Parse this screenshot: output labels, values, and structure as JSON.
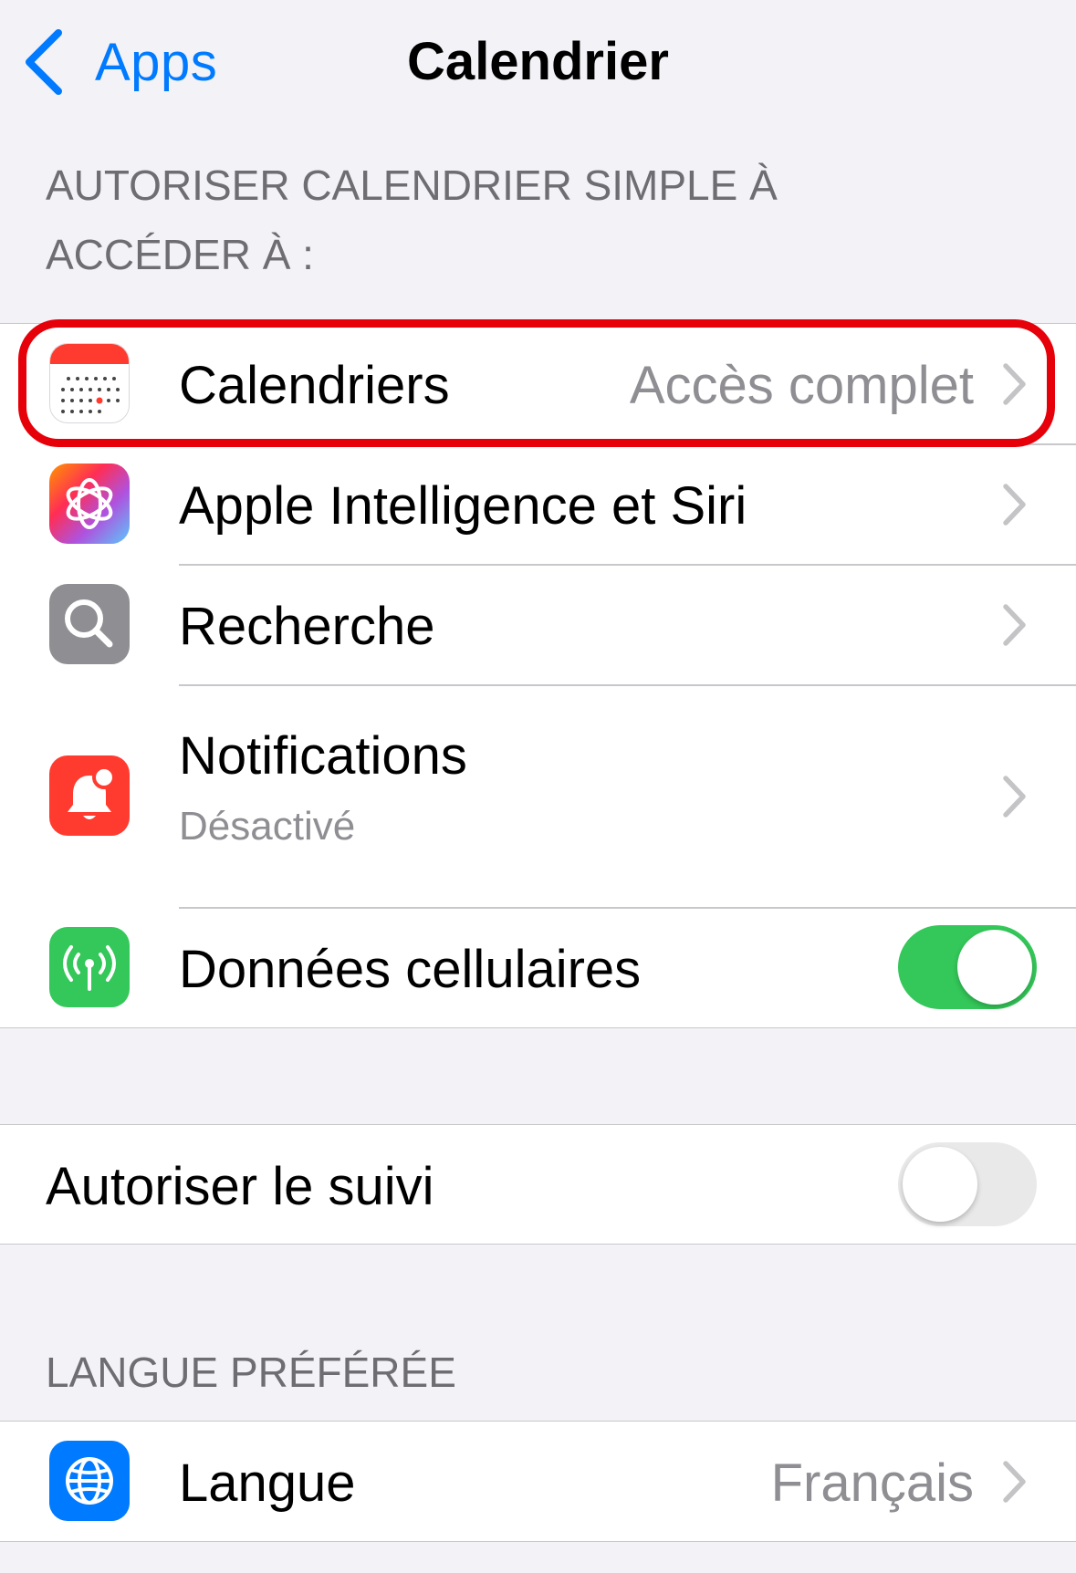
{
  "nav": {
    "back_label": "Apps",
    "title": "Calendrier"
  },
  "section_access": {
    "header_line1": "AUTORISER CALENDRIER SIMPLE À",
    "header_line2": "ACCÉDER À :",
    "rows": [
      {
        "label": "Calendriers",
        "value": "Accès complet",
        "icon": "calendar-icon",
        "color": "#ff3b30"
      },
      {
        "label": "Apple Intelligence et Siri",
        "icon": "apple-intelligence-icon"
      },
      {
        "label": "Recherche",
        "icon": "search-icon",
        "color": "#8e8e93"
      },
      {
        "label": "Notifications",
        "sublabel": "Désactivé",
        "icon": "bell-icon",
        "color": "#ff3b30"
      },
      {
        "label": "Données cellulaires",
        "icon": "antenna-icon",
        "color": "#34c759",
        "toggle": true
      }
    ]
  },
  "tracking": {
    "label": "Autoriser le suivi",
    "toggle": false
  },
  "section_language": {
    "header": "LANGUE PRÉFÉRÉE",
    "row": {
      "label": "Langue",
      "value": "Français",
      "icon": "globe-icon",
      "color": "#007aff"
    }
  },
  "colors": {
    "accent": "#007aff",
    "highlight": "#e6000a",
    "toggle_on": "#34c759"
  }
}
